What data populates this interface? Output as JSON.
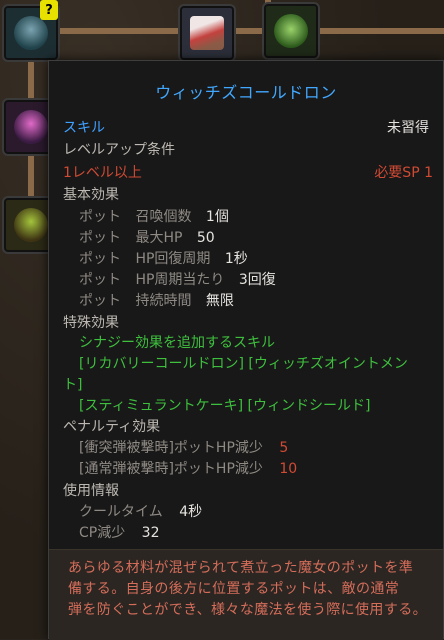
{
  "skill_tree": {
    "nodes": [
      {
        "name": "cauldron",
        "color": "#2f5a64"
      },
      {
        "name": "cake",
        "color": "#7a5a48"
      },
      {
        "name": "goblin",
        "color": "#3c7a2e"
      },
      {
        "name": "pink-cauldron",
        "color": "#7a2f6e"
      },
      {
        "name": "green-cauldron",
        "color": "#4a6a1e"
      }
    ],
    "question_badge": "?"
  },
  "tooltip": {
    "title": "ウィッチズコールドロン",
    "type_label": "スキル",
    "status": "未習得",
    "levelup_label": "レベルアップ条件",
    "level_req": "1レベル以上",
    "sp_req": "必要SP 1",
    "basic_effect_label": "基本効果",
    "basic_effects": [
      {
        "target": "ポット",
        "stat": "召喚個数",
        "value": "1個"
      },
      {
        "target": "ポット",
        "stat": "最大HP",
        "value": "50"
      },
      {
        "target": "ポット",
        "stat": "HP回復周期",
        "value": "1秒"
      },
      {
        "target": "ポット",
        "stat": "HP周期当たり",
        "value": "3回復"
      },
      {
        "target": "ポット",
        "stat": "持続時間",
        "value": "無限"
      }
    ],
    "special_effect_label": "特殊効果",
    "synergy_label": "シナジー効果を追加するスキル",
    "synergy_line1": "[リカバリーコールドロン] [ウィッチズオイントメン",
    "synergy_line2": "ト]",
    "synergy_line3": "[スティミュラントケーキ] [ウィンドシールド]",
    "penalty_label": "ペナルティ効果",
    "penalties": [
      {
        "text": "[衝突弾被撃時]ポットHP減少",
        "value": "5"
      },
      {
        "text": "[通常弾被撃時]ポットHP減少",
        "value": "10"
      }
    ],
    "usage_label": "使用情報",
    "usage": [
      {
        "stat": "クールタイム",
        "value": "4秒"
      },
      {
        "stat": "CP減少",
        "value": "32"
      }
    ],
    "description": [
      "あらゆる材料が混ぜられて煮立った魔女のポットを準",
      "備する。自身の後方に位置するポットは、敵の通常",
      "弾を防ぐことができ、様々な魔法を使う際に使用する。"
    ]
  }
}
